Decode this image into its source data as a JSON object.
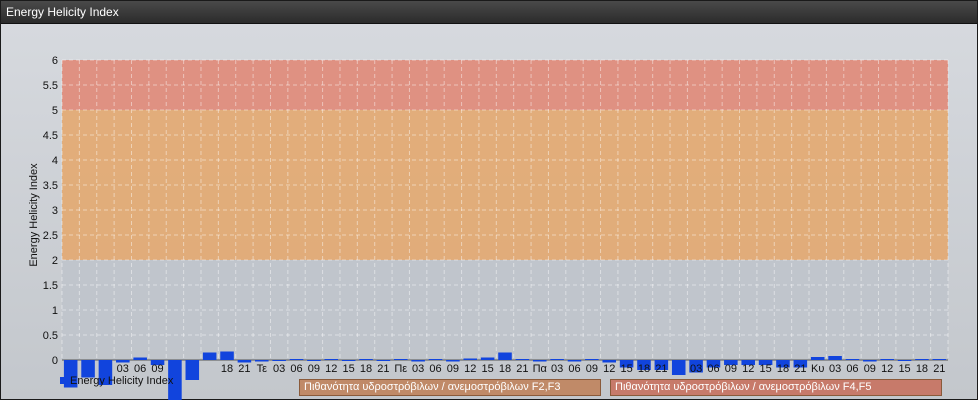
{
  "window": {
    "title": "Energy Helicity Index"
  },
  "chart_data": {
    "type": "bar",
    "title": "",
    "ylabel": "Energy Helicity Index",
    "xlabel": "",
    "ylim": [
      0,
      6
    ],
    "y_ticks": [
      "0",
      "0.5",
      "1",
      "1.5",
      "2",
      "2.5",
      "3",
      "3.5",
      "4",
      "4.5",
      "5",
      "5.5",
      "6"
    ],
    "bands": [
      {
        "from": 0,
        "to": 2,
        "color": "#bfc4cb"
      },
      {
        "from": 2,
        "to": 5,
        "color": "#e3a870"
      },
      {
        "from": 5,
        "to": 6,
        "color": "#e08a78"
      }
    ],
    "x_labels": [
      "",
      "",
      "",
      "03",
      "06",
      "09",
      "",
      "",
      "",
      "18",
      "21",
      "Τε",
      "03",
      "06",
      "09",
      "12",
      "15",
      "18",
      "21",
      "Πε",
      "03",
      "06",
      "09",
      "12",
      "15",
      "18",
      "21",
      "Πα",
      "03",
      "06",
      "09",
      "12",
      "15",
      "18",
      "21",
      "",
      "03",
      "06",
      "09",
      "12",
      "15",
      "18",
      "21",
      "Κυ",
      "03",
      "06",
      "09",
      "12",
      "15",
      "18",
      "21"
    ],
    "values": [
      -0.55,
      -0.35,
      -0.5,
      -0.05,
      0.05,
      -0.1,
      -0.8,
      -0.4,
      0.15,
      0.17,
      -0.05,
      -0.03,
      -0.02,
      0.02,
      -0.02,
      0.02,
      -0.02,
      0.02,
      -0.02,
      0.02,
      -0.03,
      0.02,
      -0.03,
      0.03,
      0.05,
      0.15,
      0.02,
      -0.03,
      0.02,
      -0.03,
      0.02,
      -0.05,
      -0.15,
      -0.2,
      -0.2,
      -0.3,
      -0.25,
      -0.15,
      -0.1,
      -0.1,
      -0.1,
      -0.15,
      -0.15,
      0.06,
      0.08,
      0.02,
      -0.03,
      0.02,
      -0.02,
      0.02,
      0.02
    ],
    "series": [
      {
        "name": "Energy Helicity Index",
        "color": "#1144dd"
      }
    ]
  },
  "legend": {
    "series_label": "Energy Helicity Index",
    "band1_label": "Πιθανότητα υδροστρόβιλων / ανεμοστρόβιλων F2,F3",
    "band2_label": "Πιθανότητα υδροστρόβιλων / ανεμοστρόβιλων F4,F5",
    "band1_color": "#c08a68",
    "band2_color": "#c77a6a"
  }
}
